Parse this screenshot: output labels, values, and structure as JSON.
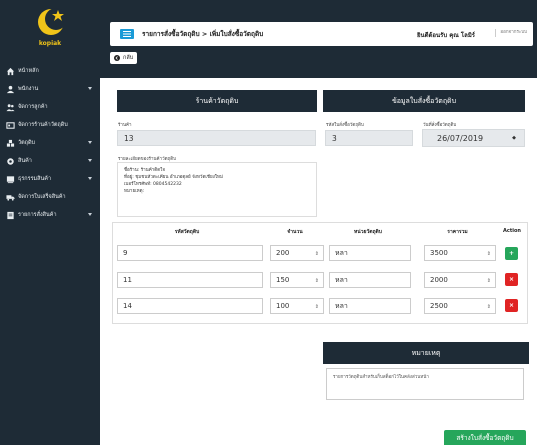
{
  "brand": {
    "name": "kopiak"
  },
  "sidebar": {
    "items": [
      {
        "label": "หน้าหลัก",
        "icon": "home-icon",
        "has_caret": false
      },
      {
        "label": "พนักงาน",
        "icon": "user-icon",
        "has_caret": true
      },
      {
        "label": "จัดการลูกค้า",
        "icon": "users-icon",
        "has_caret": false
      },
      {
        "label": "จัดการร้านค้าวัตถุดิบ",
        "icon": "store-icon",
        "has_caret": false
      },
      {
        "label": "วัตถุดิบ",
        "icon": "cubes-icon",
        "has_caret": true
      },
      {
        "label": "สินค้า",
        "icon": "product-icon",
        "has_caret": true
      },
      {
        "label": "ธุรกรรมสินค้า",
        "icon": "cart-icon",
        "has_caret": true
      },
      {
        "label": "จัดการใบเสร็จสินค้า",
        "icon": "truck-icon",
        "has_caret": false
      },
      {
        "label": "รายการสั่งสินค้า",
        "icon": "list-icon",
        "has_caret": true
      }
    ]
  },
  "header": {
    "breadcrumb": "รายการสั่งซื้อวัตถุดิบ > เพิ่มใบสั่งซื้อวัตถุดิบ",
    "user": "ยินดีต้อนรับ คุณ โลมิร์",
    "logout": "ออกจากระบบ",
    "back_label": "กลับ"
  },
  "store_section": {
    "title": "ร้านค้าวัตถุดิบ",
    "store_label": "ร้านค้า",
    "store_value": "13",
    "address_label": "รายละเอียดของร้านค้าวัตถุดิบ",
    "address_lines": [
      "ชื่อร้าน: ร้านค้าติดใจ",
      "ที่อยู่: ชุมชนหัวตะเคียน อำเภอตุลย์ จังหวัดเชียงใหม่",
      "เบอร์โทรศัพท์: 0804542232",
      "หมายเหตุ:"
    ]
  },
  "order_section": {
    "title": "ข้อมูลใบสั่งซื้อวัตถุดิบ",
    "order_no_label": "รหัสใบสั่งซื้อวัตถุดิบ",
    "order_no_value": "3",
    "date_label": "วันที่สั่งซื้อวัตถุดิบ",
    "date_value": "26/07/2019"
  },
  "items_table": {
    "headers": [
      "รหัสวัตถุดิบ",
      "จำนวน",
      "หน่วยวัตถุดิบ",
      "ราคารวม",
      "Action"
    ],
    "rows": [
      {
        "code": "9",
        "qty": "200",
        "unit": "หลา",
        "total": "3500",
        "action": "add"
      },
      {
        "code": "11",
        "qty": "150",
        "unit": "หลา",
        "total": "2000",
        "action": "delete"
      },
      {
        "code": "14",
        "qty": "100",
        "unit": "หลา",
        "total": "2500",
        "action": "delete"
      }
    ]
  },
  "note_section": {
    "title": "หมายเหตุ",
    "text": "รายการวัตถุดิบสำหรับเก็บสต็อกไว้ในคลังส่วนหน้า"
  },
  "submit_label": "สร้างใบสั่งซื้อวัตถุดิบ"
}
